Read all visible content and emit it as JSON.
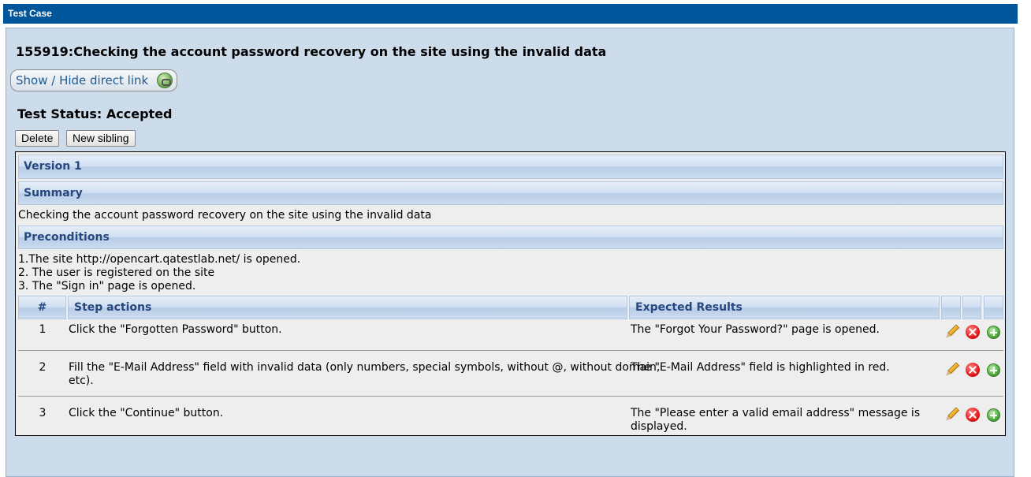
{
  "window": {
    "title": "Test Case"
  },
  "testcase": {
    "title": "155919:Checking the account password recovery on the site using the invalid data",
    "direct_link_label": "Show / Hide direct link",
    "status": "Test Status: Accepted",
    "buttons": {
      "delete": "Delete",
      "new_sibling": "New sibling"
    }
  },
  "version": {
    "label": "Version 1"
  },
  "summary": {
    "header": "Summary",
    "text": "Checking the account password recovery on the site using the invalid data"
  },
  "preconditions": {
    "header": "Preconditions",
    "lines": [
      "1.The site http://opencart.qatestlab.net/  is opened.",
      "2. The user is registered on the site",
      "3. The \"Sign in\" page is opened."
    ]
  },
  "steps": {
    "columns": {
      "num": "#",
      "actions": "Step actions",
      "expected": "Expected Results"
    },
    "rows": [
      {
        "num": "1",
        "action": "Click the \"Forgotten Password\" button.",
        "expected": "The \"Forgot Your Password?\" page is opened."
      },
      {
        "num": "2",
        "action_line1": "Fill the \"E-Mail Address\" field with invalid data (only numbers, special symbols, without @, without domain,",
        "action_line2": "etc).",
        "expected": "The \"E-Mail Address\" field is highlighted in red."
      },
      {
        "num": "3",
        "action": "Click the \"Continue\" button.",
        "expected_line1": "The \"Please enter a valid email address\" message is",
        "expected_line2": "displayed."
      }
    ],
    "row_icons": [
      "pencil-icon",
      "delete-icon",
      "add-icon"
    ]
  }
}
